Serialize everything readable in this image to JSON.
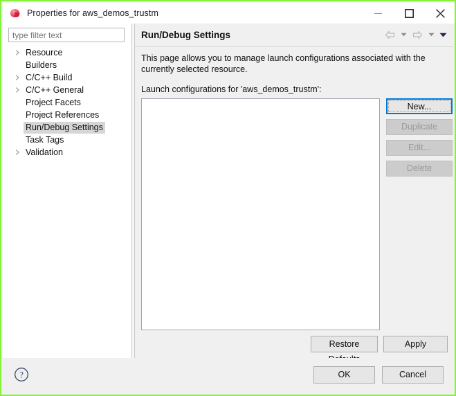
{
  "window": {
    "title": "Properties for aws_demos_trustm",
    "icon": "eclipse-icon",
    "border_color": "#85f238",
    "controls": {
      "minimize": "minimize-button",
      "maximize": "maximize-button",
      "close": "close-button"
    }
  },
  "sidebar": {
    "filter": {
      "value": "",
      "placeholder": "type filter text"
    },
    "items": [
      {
        "label": "Resource",
        "expandable": true,
        "selected": false
      },
      {
        "label": "Builders",
        "expandable": false,
        "selected": false
      },
      {
        "label": "C/C++ Build",
        "expandable": true,
        "selected": false
      },
      {
        "label": "C/C++ General",
        "expandable": true,
        "selected": false
      },
      {
        "label": "Project Facets",
        "expandable": false,
        "selected": false
      },
      {
        "label": "Project References",
        "expandable": false,
        "selected": false
      },
      {
        "label": "Run/Debug Settings",
        "expandable": false,
        "selected": true
      },
      {
        "label": "Task Tags",
        "expandable": false,
        "selected": false
      },
      {
        "label": "Validation",
        "expandable": true,
        "selected": false
      }
    ]
  },
  "page": {
    "title": "Run/Debug Settings",
    "nav": {
      "back": "back-arrow",
      "back_menu": "back-dropdown",
      "forward": "forward-arrow",
      "forward_menu": "forward-dropdown",
      "menu": "view-menu"
    },
    "description": "This page allows you to manage launch configurations associated with the currently selected resource.",
    "list_label": "Launch configurations for 'aws_demos_trustm':",
    "list_items": [],
    "side_buttons": [
      {
        "label": "New...",
        "enabled": true,
        "focused": true
      },
      {
        "label": "Duplicate",
        "enabled": false,
        "focused": false
      },
      {
        "label": "Edit...",
        "enabled": false,
        "focused": false
      },
      {
        "label": "Delete",
        "enabled": false,
        "focused": false
      }
    ],
    "restore_defaults": "Restore Defaults",
    "apply": "Apply"
  },
  "footer": {
    "help": "help-icon",
    "ok": "OK",
    "cancel": "Cancel"
  }
}
